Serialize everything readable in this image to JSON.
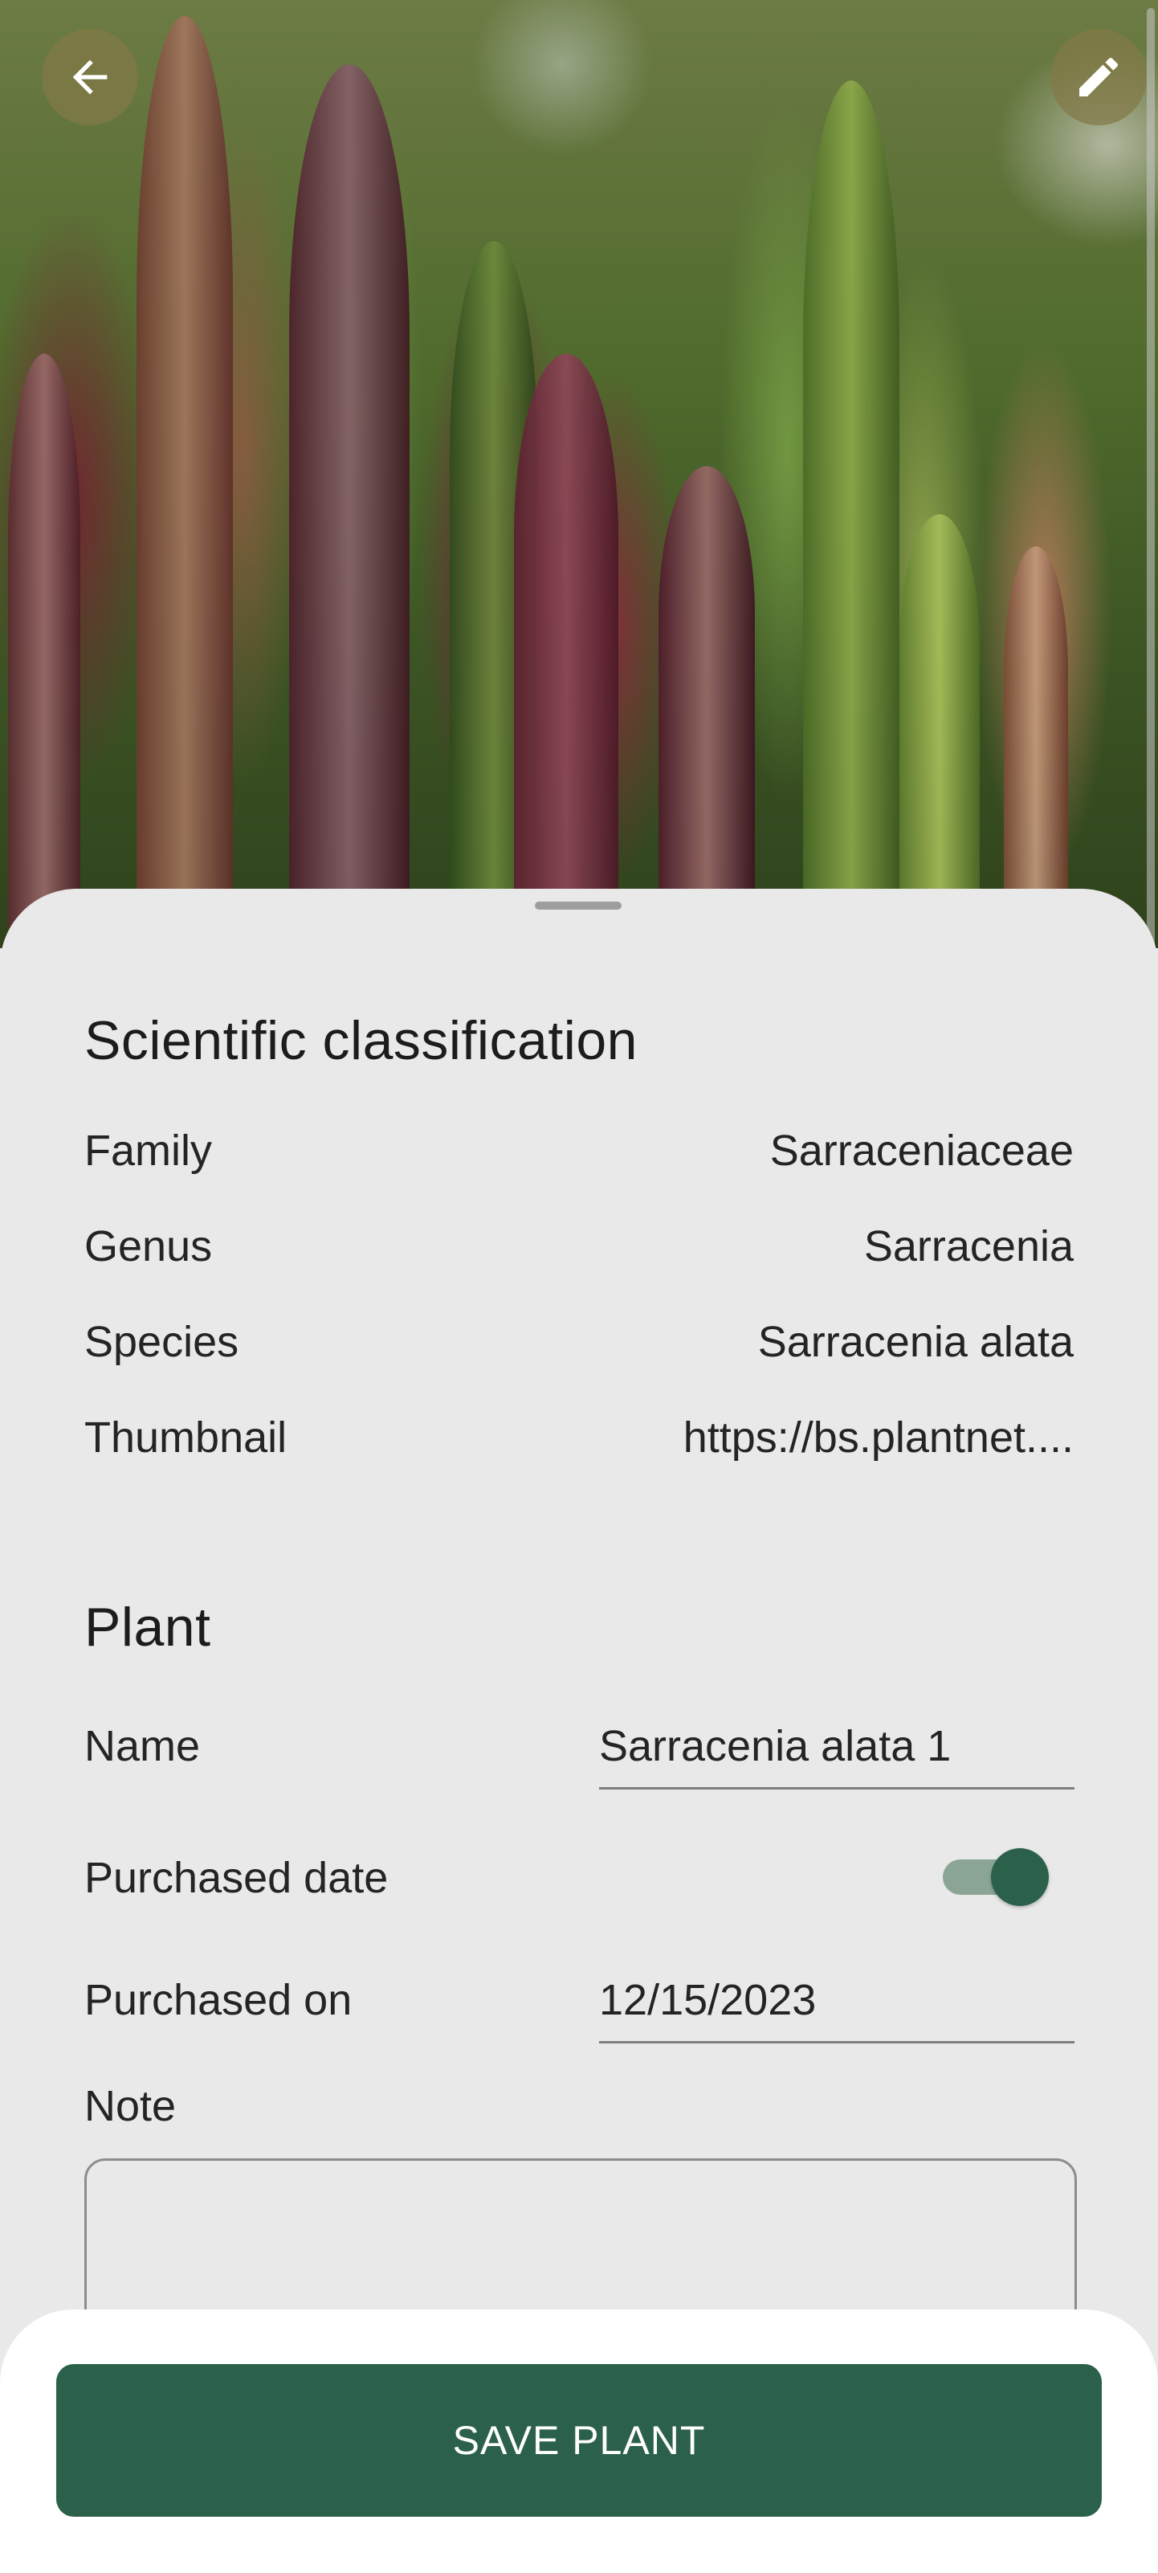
{
  "header": {
    "back_icon": "arrow-left-icon",
    "edit_icon": "pencil-icon"
  },
  "classification": {
    "title": "Scientific classification",
    "rows": [
      {
        "label": "Family",
        "value": "Sarraceniaceae"
      },
      {
        "label": "Genus",
        "value": "Sarracenia"
      },
      {
        "label": "Species",
        "value": "Sarracenia alata"
      },
      {
        "label": "Thumbnail",
        "value": "https://bs.plantnet...."
      }
    ]
  },
  "plant": {
    "title": "Plant",
    "name_label": "Name",
    "name_value": "Sarracenia alata 1",
    "purchased_date_label": "Purchased date",
    "purchased_date_enabled": true,
    "purchased_on_label": "Purchased on",
    "purchased_on_value": "12/15/2023",
    "note_label": "Note",
    "note_value": ""
  },
  "actions": {
    "save_label": "SAVE PLANT"
  },
  "colors": {
    "accent": "#2b614a",
    "sheet_background": "#e9e9e9",
    "toggle_track": "#8aa596"
  }
}
